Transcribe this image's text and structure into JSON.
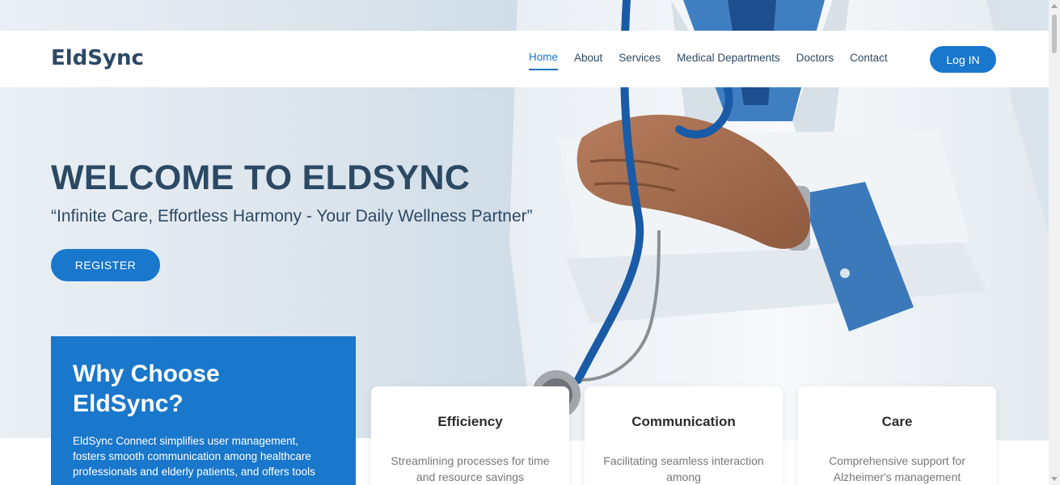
{
  "brand": {
    "name": "EldSync",
    "accent": "#1977cc",
    "heading_color": "#2c4964"
  },
  "nav": {
    "items": [
      {
        "label": "Home",
        "active": true
      },
      {
        "label": "About",
        "active": false
      },
      {
        "label": "Services",
        "active": false
      },
      {
        "label": "Medical Departments",
        "active": false
      },
      {
        "label": "Doctors",
        "active": false
      },
      {
        "label": "Contact",
        "active": false
      }
    ],
    "login_label": "Log IN"
  },
  "hero": {
    "title": "WELCOME TO ELDSYNC",
    "subtitle": "“Infinite Care, Effortless Harmony - Your Daily Wellness Partner”",
    "register_label": "REGISTER",
    "image_icon": "doctor-with-stethoscope"
  },
  "why": {
    "title": "Why Choose EldSync?",
    "text": "EldSync Connect simplifies user management, fosters smooth communication among healthcare professionals and elderly patients, and offers tools"
  },
  "features": [
    {
      "title": "Efficiency",
      "text": "Streamlining processes for time and resource savings"
    },
    {
      "title": "Communication",
      "text": "Facilitating seamless interaction among"
    },
    {
      "title": "Care",
      "text": "Comprehensive support for Alzheimer's management"
    }
  ]
}
